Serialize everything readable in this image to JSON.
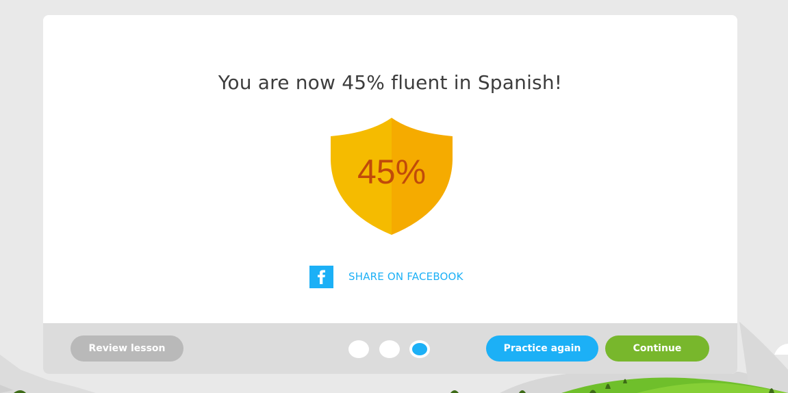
{
  "completion": {
    "headline": "You are now 45% fluent in Spanish!",
    "badge": {
      "icon": "shield-icon",
      "text": "45%",
      "fluency_percent": 45,
      "colors": {
        "left": "#f5bb00",
        "right": "#f5ab00",
        "text": "#c04a0a"
      }
    },
    "share": {
      "icon": "facebook-icon",
      "label": "SHARE ON FACEBOOK"
    }
  },
  "footer": {
    "review_label": "Review lesson",
    "practice_label": "Practice again",
    "continue_label": "Continue",
    "progress": {
      "total_steps": 3,
      "current_step": 3
    }
  },
  "colors": {
    "accent_blue": "#1cb0f6",
    "accent_green": "#78b72c",
    "neutral_button": "#b9b9b9",
    "footer_bg": "#dcdcdc",
    "page_bg": "#e9e9e9",
    "text": "#3c3c3c"
  }
}
